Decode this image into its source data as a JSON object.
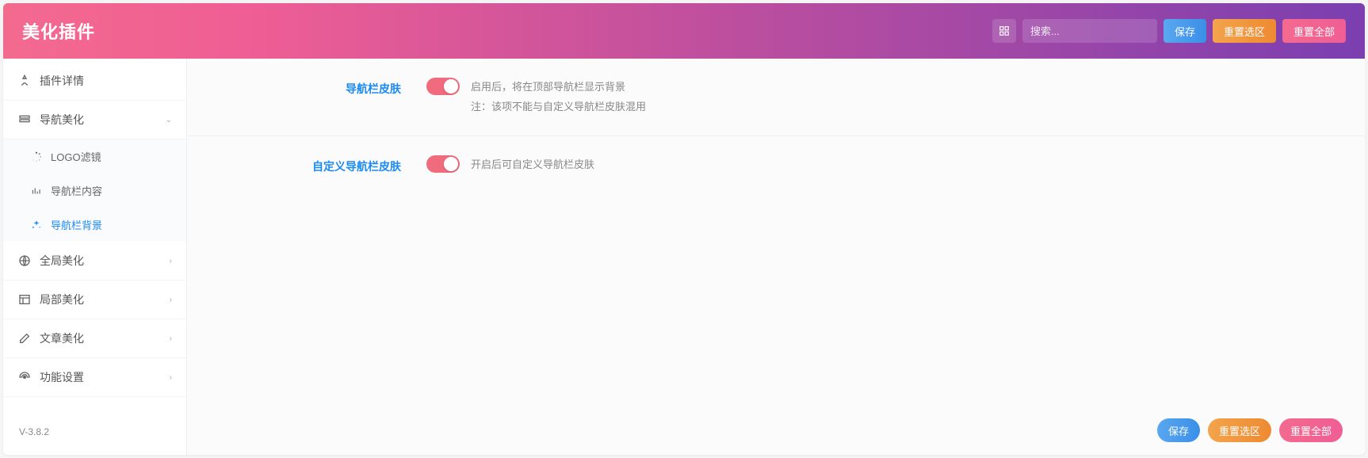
{
  "header": {
    "title": "美化插件",
    "search_placeholder": "搜索...",
    "save_label": "保存",
    "reset_section_label": "重置选区",
    "reset_all_label": "重置全部"
  },
  "sidebar": {
    "items": [
      {
        "label": "插件详情",
        "icon": "plugin-icon"
      },
      {
        "label": "导航美化",
        "icon": "nav-icon",
        "expanded": true,
        "children": [
          {
            "label": "LOGO滤镜",
            "icon": "spinner-icon"
          },
          {
            "label": "导航栏内容",
            "icon": "bars-icon"
          },
          {
            "label": "导航栏背景",
            "icon": "sparkle-icon",
            "active": true
          }
        ]
      },
      {
        "label": "全局美化",
        "icon": "globe-icon",
        "expandable": true
      },
      {
        "label": "局部美化",
        "icon": "layout-icon",
        "expandable": true
      },
      {
        "label": "文章美化",
        "icon": "edit-icon",
        "expandable": true
      },
      {
        "label": "功能设置",
        "icon": "gauge-icon",
        "expandable": true
      }
    ],
    "version": "V-3.8.2"
  },
  "content": {
    "rows": [
      {
        "label": "导航栏皮肤",
        "toggle_on": true,
        "desc": [
          "启用后，将在顶部导航栏显示背景",
          "注：该项不能与自定义导航栏皮肤混用"
        ]
      },
      {
        "label": "自定义导航栏皮肤",
        "toggle_on": true,
        "desc": [
          "开启后可自定义导航栏皮肤"
        ]
      }
    ]
  },
  "footer": {
    "save_label": "保存",
    "reset_section_label": "重置选区",
    "reset_all_label": "重置全部"
  }
}
